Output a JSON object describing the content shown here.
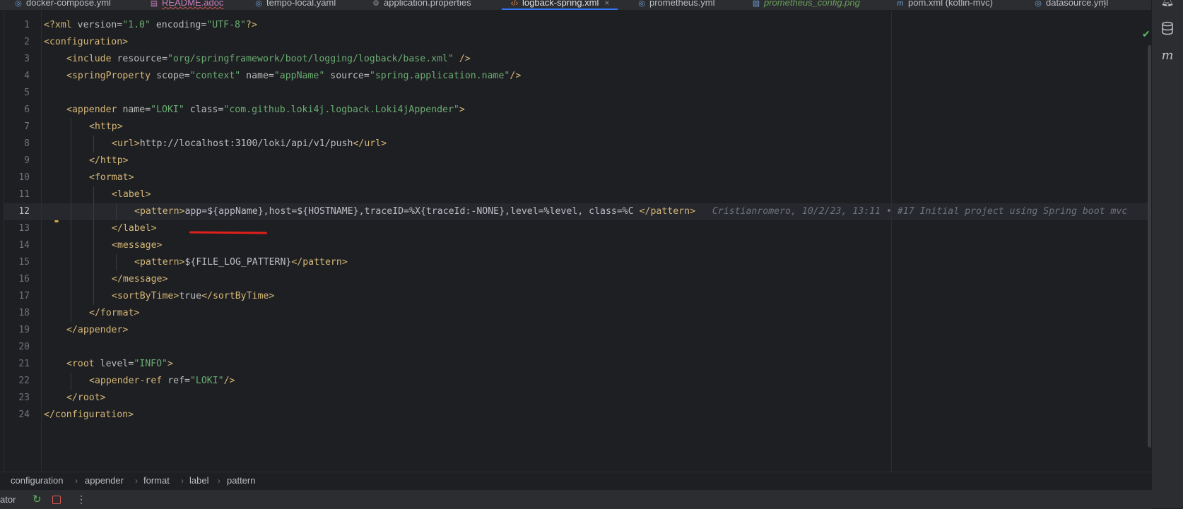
{
  "tabs": [
    {
      "label": "docker-compose.yml",
      "icon": "yaml-icon",
      "state": "normal"
    },
    {
      "label": "README.adoc",
      "icon": "asciidoc-icon",
      "state": "readme"
    },
    {
      "label": "tempo-local.yaml",
      "icon": "yaml-icon",
      "state": "normal"
    },
    {
      "label": "application.properties",
      "icon": "properties-icon",
      "state": "normal"
    },
    {
      "label": "logback-spring.xml",
      "icon": "xml-icon",
      "state": "active"
    },
    {
      "label": "prometheus.yml",
      "icon": "yaml-icon",
      "state": "normal"
    },
    {
      "label": "prometheus_config.png",
      "icon": "image-icon",
      "state": "image"
    },
    {
      "label": "pom.xml (kotlin-mvc)",
      "icon": "maven-icon",
      "state": "normal"
    },
    {
      "label": "datasource.yml",
      "icon": "yaml-icon",
      "state": "normal"
    }
  ],
  "editor": {
    "current_line": 12,
    "lines": [
      "1",
      "2",
      "3",
      "4",
      "5",
      "6",
      "7",
      "8",
      "9",
      "10",
      "11",
      "12",
      "13",
      "14",
      "15",
      "16",
      "17",
      "18",
      "19",
      "20",
      "21",
      "22",
      "23",
      "24"
    ],
    "code": {
      "l1": {
        "a": "<?",
        "b": "xml ",
        "c": "version",
        "d": "=",
        "e": "\"1.0\"",
        "f": " encoding",
        "g": "=",
        "h": "\"UTF-8\"",
        "i": "?>"
      },
      "l2": {
        "tag": "configuration"
      },
      "l3": {
        "tag": "include",
        "attr": "resource",
        "val": "\"org/springframework/boot/logging/logback/base.xml\"",
        "end": " />"
      },
      "l4": {
        "tag": "springProperty",
        "a1": "scope",
        "v1": "\"context\"",
        "a2": "name",
        "v2": "\"appName\"",
        "a3": "source",
        "v3": "\"spring.application.name\"",
        "end": "/>"
      },
      "l6": {
        "tag": "appender",
        "a1": "name",
        "v1": "\"LOKI\"",
        "a2": "class",
        "v2": "\"com.github.loki4j.logback.Loki4jAppender\""
      },
      "l7": {
        "tag": "http"
      },
      "l8": {
        "tag": "url",
        "text": "http://localhost:3100/loki/api/v1/push"
      },
      "l9": {
        "tag": "http"
      },
      "l10": {
        "tag": "format"
      },
      "l11": {
        "tag": "label"
      },
      "l12": {
        "tag": "pattern",
        "text": "app=${appName},host=${HOSTNAME},traceID=%X{traceId:-NONE},level=%level, class=%C ",
        "blame": "Cristianromero, 10/2/23, 13:11 • #17 Initial project using Spring boot mvc"
      },
      "l13": {
        "tag": "label"
      },
      "l14": {
        "tag": "message"
      },
      "l15": {
        "tag": "pattern",
        "text": "${FILE_LOG_PATTERN}"
      },
      "l16": {
        "tag": "message"
      },
      "l17": {
        "tag": "sortByTime",
        "text": "true"
      },
      "l18": {
        "tag": "format"
      },
      "l19": {
        "tag": "appender"
      },
      "l21": {
        "tag": "root",
        "attr": "level",
        "val": "\"INFO\""
      },
      "l22": {
        "tag": "appender-ref",
        "attr": "ref",
        "val": "\"LOKI\"",
        "end": "/>"
      },
      "l23": {
        "tag": "root"
      },
      "l24": {
        "tag": "configuration"
      }
    }
  },
  "breadcrumbs": [
    "configuration",
    "appender",
    "format",
    "label",
    "pattern"
  ],
  "bottombar": {
    "left_label": "ator"
  },
  "colors": {
    "accent": "#3574f0",
    "tag": "#d5b778",
    "string": "#6aab73",
    "annotation_underline": "#e0201b"
  }
}
